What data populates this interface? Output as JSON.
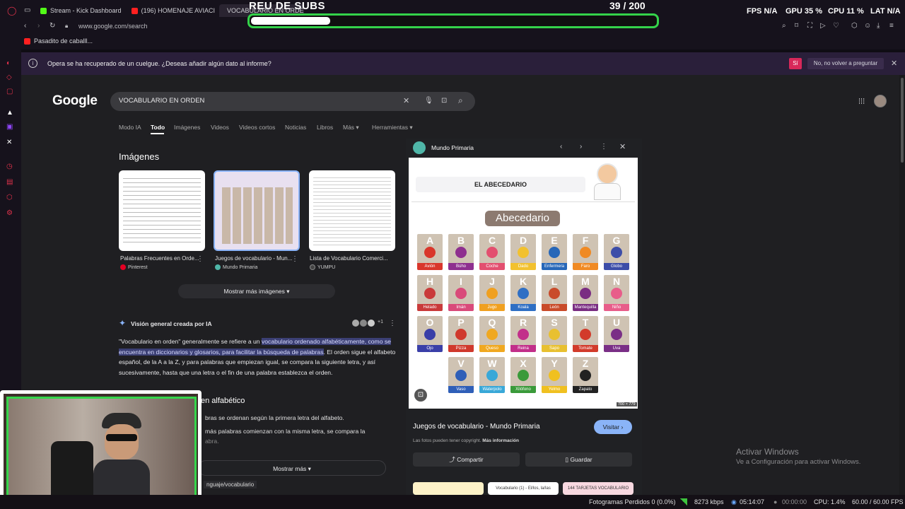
{
  "browser": {
    "tabs": [
      {
        "label": "Stream - Kick Dashboard"
      },
      {
        "label": "(196) HOMENAJE AVIACI"
      },
      {
        "label": "VOCABULARIO EN ORDE"
      }
    ],
    "url": "www.google.com/search",
    "bookmark": "Pasadito de caballl...",
    "hud": {
      "fps_label": "FPS",
      "fps_value": "N/A",
      "gpu_label": "GPU",
      "gpu_value": "35 %",
      "cpu_label": "CPU",
      "cpu_value": "11 %",
      "lat_label": "LAT",
      "lat_value": "N/A"
    }
  },
  "overlay": {
    "title": "REU DE SUBS",
    "count": "39 / 200",
    "progress_fraction": 0.195
  },
  "notification": {
    "text": "Opera se ha recuperado de un cuelgue. ¿Deseas añadir algún dato al informe?",
    "yes_label": "Sí",
    "no_label": "No, no volver a preguntar"
  },
  "google": {
    "logo": "Google",
    "query": "VOCABULARIO EN ORDEN",
    "tabs": [
      "Modo IA",
      "Todo",
      "Imágenes",
      "Videos",
      "Videos cortos",
      "Noticias",
      "Libros",
      "Más",
      "Herramientas"
    ],
    "images_heading": "Imágenes",
    "thumbs": [
      {
        "caption": "Palabras Frecuentes en Orde...",
        "source": "Pinterest",
        "color": "#e60023"
      },
      {
        "caption": "Juegos de vocabulario - Mun...",
        "source": "Mundo Primaria",
        "color": "#4fb6a8"
      },
      {
        "caption": "Lista de Vocabulario Comerci...",
        "source": "YUMPU",
        "color": "#222222"
      }
    ],
    "more_images": "Mostrar más imágenes",
    "ai": {
      "title": "Visión general creada por IA",
      "extra": "+1",
      "p1_a": "\"Vocabulario en orden\" generalmente se refiere a un ",
      "p1_hl": "vocabulario ordenado alfabéticamente, como se encuentra en diccionarios y glosarios, para facilitar la búsqueda de palabras",
      "p1_b": ". El orden sigue el alfabeto español, de la A a la Z, y para palabras que empiezan igual, se compara la siguiente letra, y así sucesivamente, hasta que una letra o el fin de una palabra establezca el orden.",
      "sub": "en alfabético",
      "sub_p1": "bras se ordenan según la primera letra del alfabeto.",
      "sub_p2": "más palabras comienzan con la misma letra, se compara la",
      "sub_p3": "abra.",
      "show_more": "Mostrar más",
      "bottom_link": "nguaje/vocabulario"
    }
  },
  "panel": {
    "source": "Mundo Primaria",
    "header": "EL ABECEDARIO",
    "abc_title": "Abecedario",
    "size_label": "700 × 779",
    "letters": [
      {
        "l": "A",
        "w": "Avión",
        "c": "#d9362b"
      },
      {
        "l": "B",
        "w": "Búho",
        "c": "#8e2f8f"
      },
      {
        "l": "C",
        "w": "Coche",
        "c": "#e34f6f"
      },
      {
        "l": "D",
        "w": "Dado",
        "c": "#f2c12e"
      },
      {
        "l": "E",
        "w": "Enfermera",
        "c": "#2767b8"
      },
      {
        "l": "F",
        "w": "Faro",
        "c": "#f08a24"
      },
      {
        "l": "G",
        "w": "Globo",
        "c": "#3c4da8"
      },
      {
        "l": "H",
        "w": "Helado",
        "c": "#c93a3a"
      },
      {
        "l": "I",
        "w": "Imán",
        "c": "#d94a7a"
      },
      {
        "l": "J",
        "w": "Jugo",
        "c": "#f0a020"
      },
      {
        "l": "K",
        "w": "Koala",
        "c": "#2f6fc4"
      },
      {
        "l": "L",
        "w": "León",
        "c": "#c94b2a"
      },
      {
        "l": "M",
        "w": "Mantequilla",
        "c": "#7a2d82"
      },
      {
        "l": "N",
        "w": "Niño",
        "c": "#e85d8a"
      },
      {
        "l": "O",
        "w": "Ojo",
        "c": "#3a3fa8"
      },
      {
        "l": "P",
        "w": "Pizza",
        "c": "#d0392d"
      },
      {
        "l": "Q",
        "w": "Queso",
        "c": "#f0a820"
      },
      {
        "l": "R",
        "w": "Reina",
        "c": "#c22f8a"
      },
      {
        "l": "S",
        "w": "Sapo",
        "c": "#e8c030"
      },
      {
        "l": "T",
        "w": "Tomate",
        "c": "#d23b2b"
      },
      {
        "l": "U",
        "w": "Uva",
        "c": "#7a2f86"
      },
      {
        "l": "V",
        "w": "Vaso",
        "c": "#2f5fb8"
      },
      {
        "l": "W",
        "w": "Waterpolo",
        "c": "#39a8d8"
      },
      {
        "l": "X",
        "w": "Xilófono",
        "c": "#3a9a3a"
      },
      {
        "l": "Y",
        "w": "Yelmo",
        "c": "#f0c020"
      },
      {
        "l": "Z",
        "w": "Zapato",
        "c": "#222222"
      }
    ],
    "title": "Juegos de vocabulario - Mundo Primaria",
    "visit_label": "Visitar",
    "copyright": "Las fotos pueden tener copyright.",
    "more_info": "Más información",
    "share_label": "Compartir",
    "save_label": "Guardar",
    "related": [
      "",
      "Vocabulario (1) - El/los, la/las",
      "144 TARJETAS VOCABULARIO"
    ]
  },
  "windows": {
    "line1": "Activar Windows",
    "line2": "Ve a Configuración para activar Windows."
  },
  "status": {
    "dropped": "Fotogramas Perdidos 0 (0.0%)",
    "bitrate": "8273 kbps",
    "live_time": "05:14:07",
    "rec_time": "00:00:00",
    "cpu": "CPU: 1.4%",
    "fps": "60.00 / 60.00 FPS"
  }
}
